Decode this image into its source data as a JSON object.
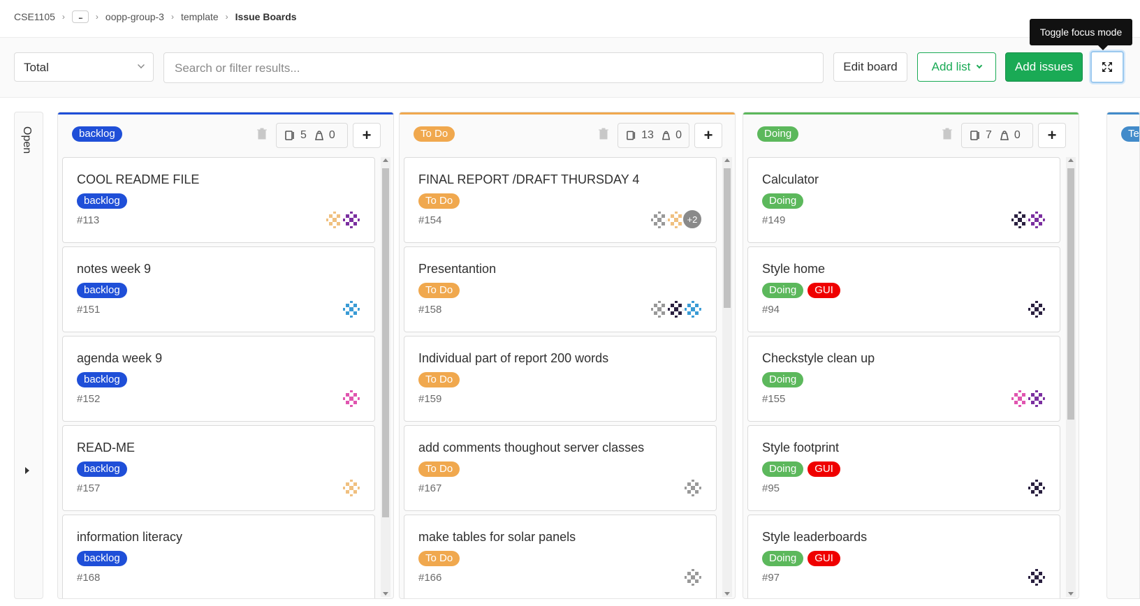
{
  "breadcrumb": {
    "items": [
      "CSE1105",
      "...",
      "oopp-group-3",
      "template"
    ],
    "current": "Issue Boards"
  },
  "toolbar": {
    "board_select": "Total",
    "search_placeholder": "Search or filter results...",
    "edit_board": "Edit board",
    "add_list": "Add list",
    "add_issues": "Add issues",
    "focus_tooltip": "Toggle focus mode"
  },
  "sidebar": {
    "open_label": "Open"
  },
  "colors": {
    "backlog": "#1f4fd8",
    "todo": "#f0a84e",
    "doing": "#5cb85c",
    "gui": "#ef0000",
    "partial": "#428bca"
  },
  "lists": [
    {
      "label": "backlog",
      "issue_count": "5",
      "weight": "0",
      "cards": [
        {
          "title": "COOL README FILE",
          "labels": [
            "backlog"
          ],
          "number": "#113"
        },
        {
          "title": "notes week 9",
          "labels": [
            "backlog"
          ],
          "number": "#151"
        },
        {
          "title": "agenda week 9",
          "labels": [
            "backlog"
          ],
          "number": "#152"
        },
        {
          "title": "READ-ME",
          "labels": [
            "backlog"
          ],
          "number": "#157"
        },
        {
          "title": "information literacy",
          "labels": [
            "backlog"
          ],
          "number": "#168"
        }
      ]
    },
    {
      "label": "To Do",
      "issue_count": "13",
      "weight": "0",
      "cards": [
        {
          "title": "FINAL REPORT /DRAFT THURSDAY 4",
          "labels": [
            "To Do"
          ],
          "number": "#154",
          "more": "+2"
        },
        {
          "title": "Presentantion",
          "labels": [
            "To Do"
          ],
          "number": "#158"
        },
        {
          "title": "Individual part of report 200 words",
          "labels": [
            "To Do"
          ],
          "number": "#159"
        },
        {
          "title": "add comments thoughout server classes",
          "labels": [
            "To Do"
          ],
          "number": "#167"
        },
        {
          "title": "make tables for solar panels",
          "labels": [
            "To Do"
          ],
          "number": "#166"
        }
      ]
    },
    {
      "label": "Doing",
      "issue_count": "7",
      "weight": "0",
      "cards": [
        {
          "title": "Calculator",
          "labels": [
            "Doing"
          ],
          "number": "#149"
        },
        {
          "title": "Style home",
          "labels": [
            "Doing",
            "GUI"
          ],
          "number": "#94"
        },
        {
          "title": "Checkstyle clean up",
          "labels": [
            "Doing"
          ],
          "number": "#155"
        },
        {
          "title": "Style footprint",
          "labels": [
            "Doing",
            "GUI"
          ],
          "number": "#95"
        },
        {
          "title": "Style leaderboards",
          "labels": [
            "Doing",
            "GUI"
          ],
          "number": "#97"
        }
      ]
    }
  ],
  "partial_list_label": "Te"
}
